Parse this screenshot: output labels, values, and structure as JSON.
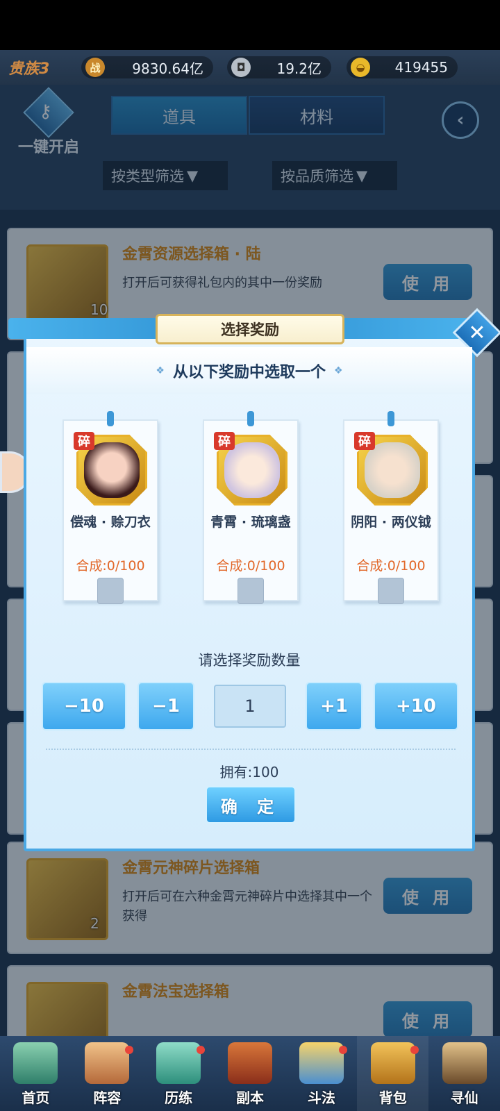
{
  "top_bar": {
    "vip": "贵族3",
    "power_icon": "战",
    "power": "9830.64亿",
    "coin": "19.2亿",
    "gold": "419455"
  },
  "header": {
    "one_key_label": "一键开启",
    "tabs": [
      {
        "label": "道具",
        "active": true
      },
      {
        "label": "材料",
        "active": false
      }
    ],
    "filters": [
      "按类型筛选",
      "按品质筛选"
    ]
  },
  "items": [
    {
      "name": "金霄资源选择箱 · 陆",
      "desc": "打开后可获得礼包内的其中一份奖励",
      "count": "10",
      "use_label": "使 用"
    },
    {
      "name": "金霄元神碎片选择箱",
      "desc": "打开后可在六种金霄元神碎片中选择其中一个获得",
      "count": "2",
      "use_label": "使 用"
    },
    {
      "name": "金霄法宝选择箱",
      "desc": "",
      "count": "",
      "use_label": "使 用"
    }
  ],
  "modal": {
    "title": "选择奖励",
    "subtitle": "从以下奖励中选取一个",
    "rewards": [
      {
        "badge": "碎",
        "name": "偿魂 · 赊刀衣",
        "progress": "合成:0/100"
      },
      {
        "badge": "碎",
        "name": "青霄 · 琉璃盏",
        "progress": "合成:0/100"
      },
      {
        "badge": "碎",
        "name": "阴阳 · 两仪钺",
        "progress": "合成:0/100"
      }
    ],
    "prompt": "请选择奖励数量",
    "buttons": {
      "minus10": "−10",
      "minus1": "−1",
      "plus1": "+1",
      "plus10": "+10"
    },
    "quantity": "1",
    "owned": "拥有:100",
    "confirm": "确 定"
  },
  "nav": [
    {
      "label": "首页",
      "dot": false,
      "active": false
    },
    {
      "label": "阵容",
      "dot": true,
      "active": false
    },
    {
      "label": "历练",
      "dot": true,
      "active": false
    },
    {
      "label": "副本",
      "dot": false,
      "active": false
    },
    {
      "label": "斗法",
      "dot": true,
      "active": false
    },
    {
      "label": "背包",
      "dot": true,
      "active": true
    },
    {
      "label": "寻仙",
      "dot": false,
      "active": false
    }
  ]
}
